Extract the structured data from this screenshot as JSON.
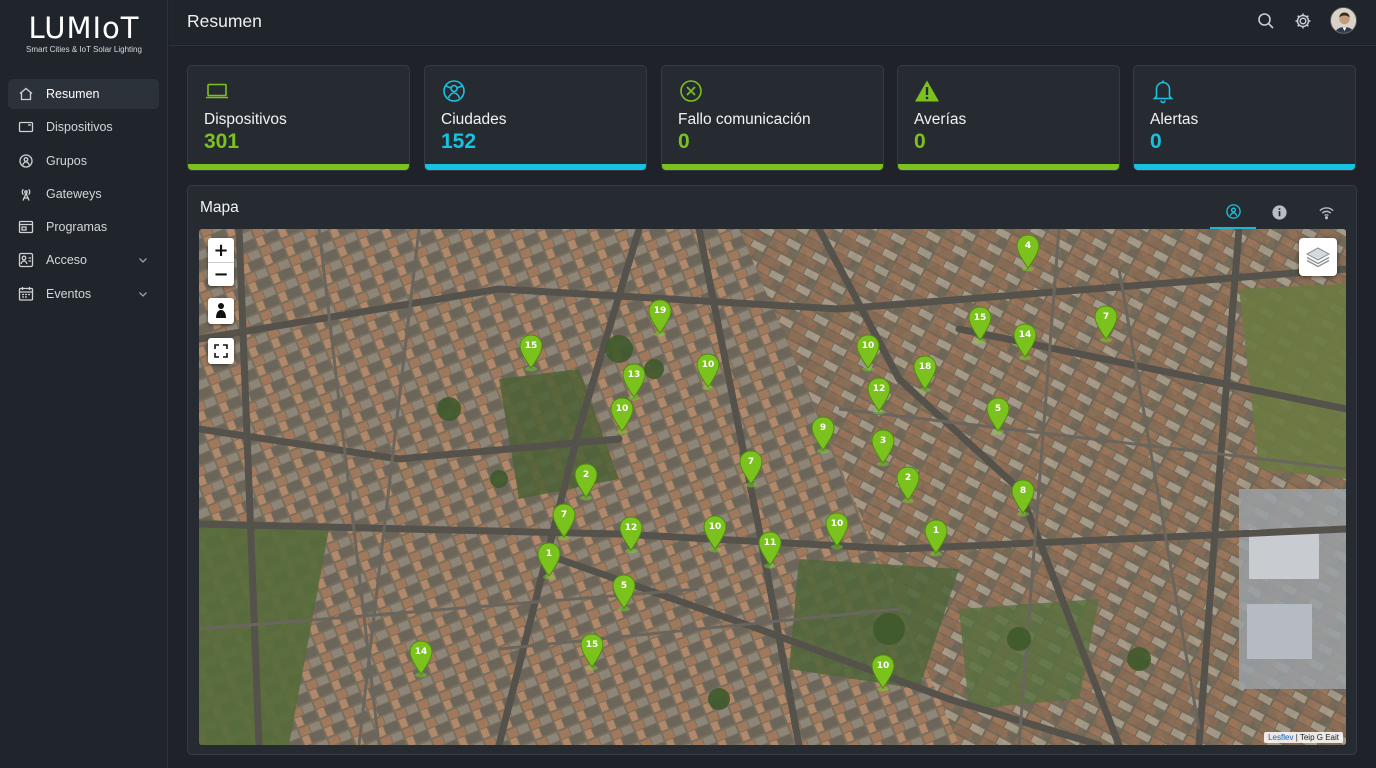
{
  "brand": {
    "name": "LUMIoT",
    "tagline": "Smart Cities & IoT Solar Lighting"
  },
  "sidebar": {
    "items": [
      {
        "label": "Resumen",
        "icon": "home-icon",
        "active": true
      },
      {
        "label": "Dispositivos",
        "icon": "device-icon"
      },
      {
        "label": "Grupos",
        "icon": "groups-icon"
      },
      {
        "label": "Gateweys",
        "icon": "antenna-icon"
      },
      {
        "label": "Programas",
        "icon": "calendar-icon"
      },
      {
        "label": "Acceso",
        "icon": "access-icon",
        "expandable": true
      },
      {
        "label": "Eventos",
        "icon": "events-icon",
        "expandable": true
      }
    ]
  },
  "header": {
    "title": "Resumen",
    "icons": [
      "search-icon",
      "gear-icon",
      "avatar"
    ]
  },
  "stats": [
    {
      "label": "Dispositivos",
      "value": "301",
      "color": "#7cc21f",
      "icon": "laptop-icon"
    },
    {
      "label": "Ciudades",
      "value": "152",
      "color": "#19c2e0",
      "icon": "city-icon"
    },
    {
      "label": "Fallo comunicación",
      "value": "0",
      "color": "#7cc21f",
      "icon": "circle-x-icon"
    },
    {
      "label": "Averías",
      "value": "0",
      "color": "#7cc21f",
      "icon": "warning-icon"
    },
    {
      "label": "Alertas",
      "value": "0",
      "color": "#19c2e0",
      "icon": "bell-icon"
    }
  ],
  "map": {
    "title": "Mapa",
    "tabs": [
      {
        "icon": "map-globe-icon",
        "active": true
      },
      {
        "icon": "info-icon",
        "active": false
      },
      {
        "icon": "wifi-icon",
        "active": false
      }
    ],
    "controls": {
      "zoom_in": "+",
      "zoom_out": "−"
    },
    "attribution": {
      "link": "Lesflev",
      "text": "Teip G Eait"
    },
    "marker_color": "#7cc21f",
    "markers": [
      "4",
      "19",
      "15",
      "15",
      "14",
      "7",
      "10",
      "13",
      "10",
      "10",
      "18",
      "12",
      "5",
      "9",
      "3",
      "7",
      "2",
      "2",
      "8",
      "7",
      "12",
      "10",
      "10",
      "11",
      "1",
      "1",
      "5",
      "15",
      "14",
      "10"
    ]
  }
}
